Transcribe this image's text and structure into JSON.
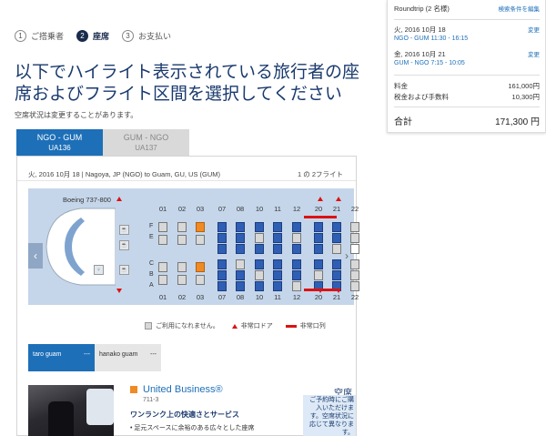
{
  "steps": [
    {
      "num": "1",
      "label": "ご搭乗者"
    },
    {
      "num": "2",
      "label": "座席"
    },
    {
      "num": "3",
      "label": "お支払い"
    }
  ],
  "page_title": "以下でハイライト表示されている旅行者の座席およびフライト区間を選択してください",
  "note": "空席状況は変更することがあります。",
  "flight_tabs": [
    {
      "route": "NGO - GUM",
      "flight": "UA136"
    },
    {
      "route": "GUM - NGO",
      "flight": "UA137"
    }
  ],
  "seatmap": {
    "flight_info": "火, 2016 10月 18 | Nagoya, JP (NGO) to Guam, GU, US (GUM)",
    "flight_count": "1 の 2フライト",
    "aircraft": "Boeing 737-800",
    "columns": [
      "01",
      "02",
      "03",
      "07",
      "08",
      "10",
      "11",
      "12",
      "20",
      "21",
      "22"
    ],
    "row_letters": [
      "F",
      "E",
      "D",
      "C",
      "B",
      "A"
    ],
    "nav_prev_icon": "chevron-left-icon",
    "nav_next_icon": "chevron-right-icon"
  },
  "legend": {
    "unavailable": "ご利用になれません。",
    "exit_door": "非常口ドア",
    "exit_row": "非常口列"
  },
  "travelers": [
    {
      "name": "taro guam",
      "seat": "---"
    },
    {
      "name": "hanako guam",
      "seat": "---"
    }
  ],
  "cabin": {
    "name": "United Business®",
    "rows": "711-3",
    "heading": "ワンランク上の快適さとサービス",
    "bullet": "• 足元スペースに余裕のある広々とした座席"
  },
  "seat_status": {
    "title": "空席",
    "text": "ご予約時にご購入いただけます。空席状況に応じて異なります。"
  },
  "summary": {
    "trip": "Roundtrip (2 名様)",
    "details_link": "検索条件を編集",
    "legs": [
      {
        "date": "火, 2016 10月 18",
        "route": "NGO - GUM 11:30 - 16:15",
        "change": "変更"
      },
      {
        "date": "金, 2016 10月 21",
        "route": "GUM - NGO 7:15 - 10:05",
        "change": "変更"
      }
    ],
    "fare_label": "料金",
    "fare": "161,000円",
    "tax_label": "税金および手数料",
    "tax": "10,300円",
    "total_label": "合計",
    "total": "171,300 円"
  },
  "colors": {
    "accent": "#1d6fb8",
    "available_seat": "#2f5fb3",
    "occupied_seat": "#f08a24",
    "exit": "#dd1111"
  }
}
